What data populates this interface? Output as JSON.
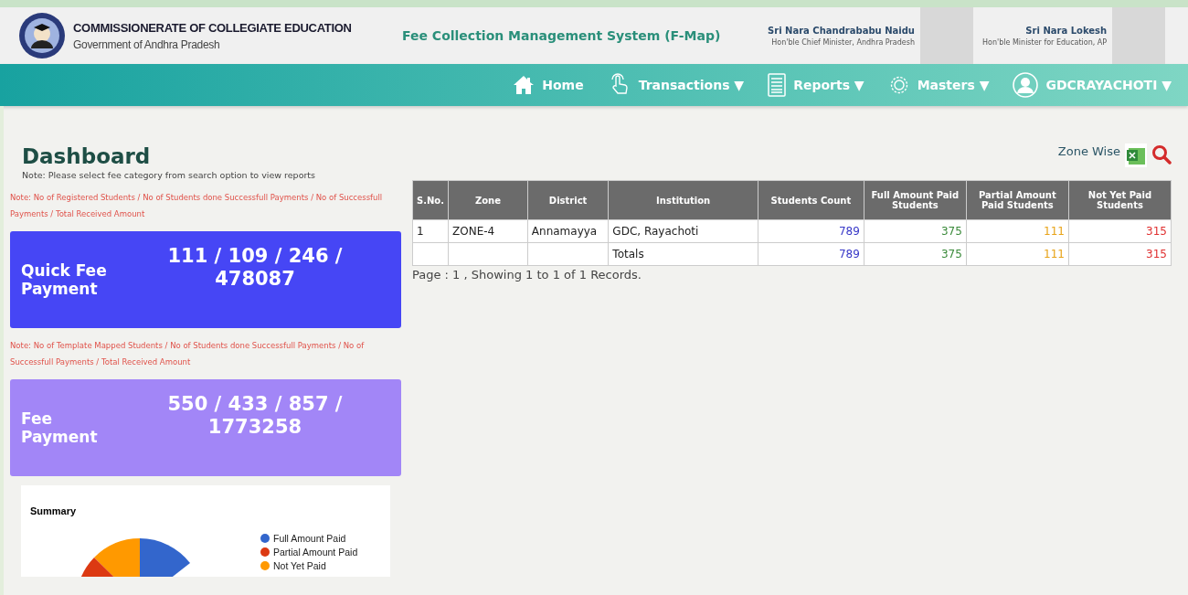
{
  "header": {
    "org_title": "COMMISSIONERATE OF COLLEGIATE EDUCATION",
    "org_subtitle": "Government of Andhra Pradesh",
    "app_title": "Fee Collection Management System (F-Map)",
    "dignitaries": [
      {
        "name": "Sri Nara Chandrababu Naidu",
        "role": "Hon'ble Chief Minister, Andhra Pradesh"
      },
      {
        "name": "Sri Nara Lokesh",
        "role": "Hon'ble Minister for Education, AP"
      }
    ]
  },
  "nav": [
    {
      "kind": "home",
      "label": "Home"
    },
    {
      "kind": "hand",
      "label": "Transactions",
      "caret": "▼"
    },
    {
      "kind": "doc",
      "label": "Reports",
      "caret": "▼"
    },
    {
      "kind": "gear",
      "label": "Masters",
      "caret": "▼"
    },
    {
      "kind": "user",
      "label": "GDCRAYACHOTI",
      "caret": "▼"
    }
  ],
  "page": {
    "title": "Dashboard",
    "note": "Note: Please select fee category from search option to view reports",
    "export_label": "Zone Wise"
  },
  "cards": [
    {
      "note": "Note: No of Registered Students / No of Students done Successfull Payments / No of Successfull Payments / Total Received Amount",
      "label": "Quick Fee Payment",
      "value": "111 / 109 / 246 / 478087",
      "color": "#4646f5"
    },
    {
      "note": "Note: No of Template Mapped Students / No of Students done Successfull Payments / No of Successfull Payments / Total Received Amount",
      "label": "Fee Payment",
      "value": "550 / 433 / 857 / 1773258",
      "color": "#a286f7"
    }
  ],
  "summary": {
    "title": "Summary",
    "legend": [
      {
        "label": "Full Amount Paid",
        "color": "#3366cc"
      },
      {
        "label": "Partial Amount Paid",
        "color": "#dc3912"
      },
      {
        "label": "Not Yet Paid",
        "color": "#ff9900"
      }
    ]
  },
  "table": {
    "columns": [
      "S.No.",
      "Zone",
      "District",
      "Institution",
      "Students Count",
      "Full Amount Paid Students",
      "Partial Amount Paid Students",
      "Not Yet Paid Students"
    ],
    "rows": [
      [
        "1",
        "ZONE-4",
        "Annamayya",
        "GDC, Rayachoti",
        "789",
        "375",
        "111",
        "315"
      ],
      [
        "",
        "",
        "",
        "Totals",
        "789",
        "375",
        "111",
        "315"
      ]
    ],
    "footer": "Page : 1 , Showing 1 to 1 of 1 Records."
  }
}
